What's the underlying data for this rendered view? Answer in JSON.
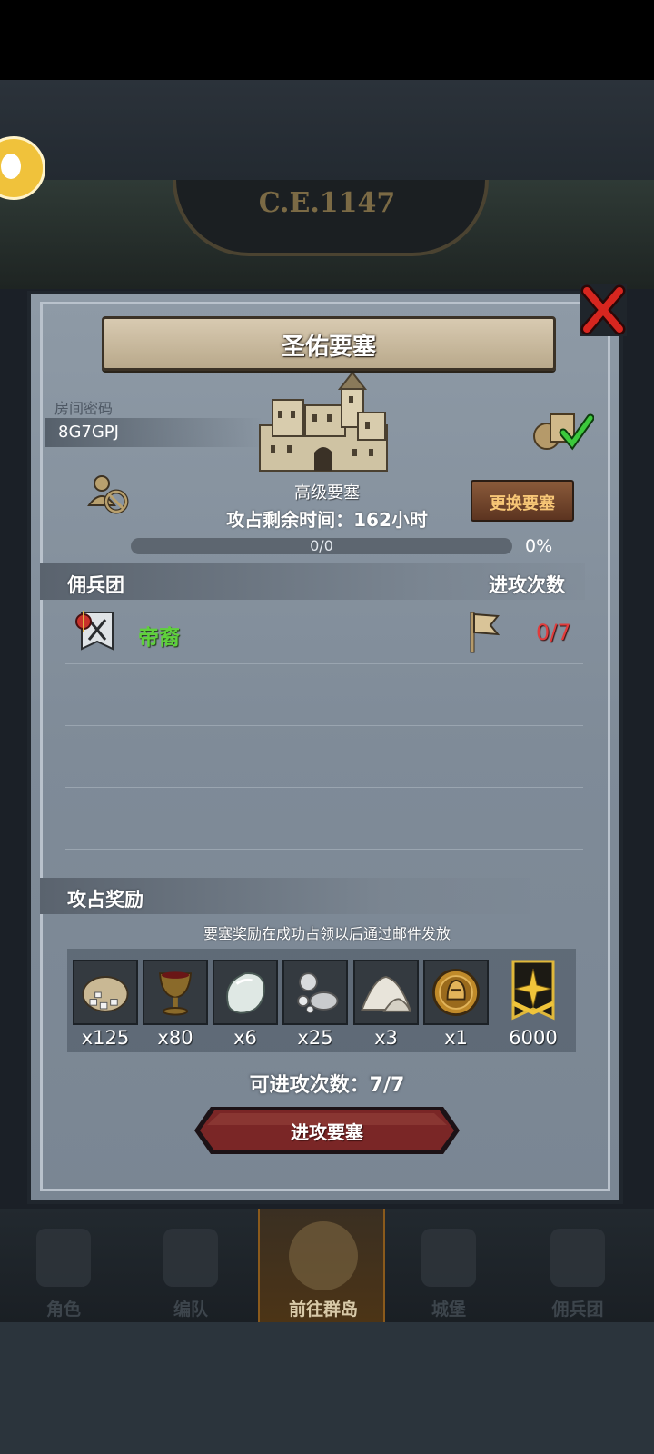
{
  "background": {
    "era_label": "C.E.1147"
  },
  "dialog": {
    "title": "圣佑要塞",
    "room_code_label": "房间密码",
    "room_code": "8G7GPJ",
    "fortress_name": "高级要塞",
    "change_button": "更换要塞",
    "remaining_time": "攻占剩余时间：162小时",
    "progress_text": "0/0",
    "progress_percent": "0%",
    "progress_value": 0,
    "mercenary_header": "佣兵团",
    "attack_count_header": "进攻次数",
    "mercenaries": [
      {
        "name": "帝裔",
        "count": "0/7"
      }
    ],
    "reward_header": "攻占奖励",
    "reward_note": "要塞奖励在成功占领以后通过邮件发放",
    "rewards": [
      {
        "icon": "ore-sack-icon",
        "qty": "x125"
      },
      {
        "icon": "goblet-icon",
        "qty": "x80"
      },
      {
        "icon": "moonstone-icon",
        "qty": "x6"
      },
      {
        "icon": "silver-orbs-icon",
        "qty": "x25"
      },
      {
        "icon": "salt-pile-icon",
        "qty": "x3"
      },
      {
        "icon": "knight-medal-icon",
        "qty": "x1"
      },
      {
        "icon": "gold-banner-icon",
        "qty": "6000"
      }
    ],
    "available_attacks": "可进攻次数：7/7",
    "attack_button": "进攻要塞"
  },
  "nav": {
    "items": [
      {
        "label": "角色",
        "icon": "knight-icon"
      },
      {
        "label": "编队",
        "icon": "helmet-icon"
      },
      {
        "label": "前往群岛",
        "icon": "compass-globe-icon",
        "active": true
      },
      {
        "label": "城堡",
        "icon": "castle-icon"
      },
      {
        "label": "佣兵团",
        "icon": "ship-icon"
      }
    ]
  },
  "colors": {
    "mercenary_name": "#5fd13c",
    "attack_count": "#e23c3c",
    "change_button_text": "#f7c676",
    "attack_button": "#7a2626"
  }
}
